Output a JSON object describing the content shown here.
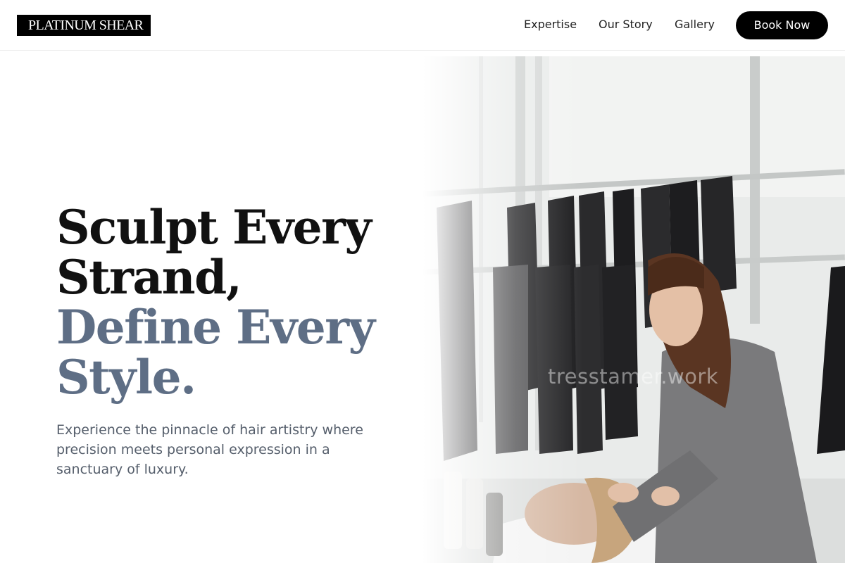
{
  "header": {
    "logo": "PLATINUM SHEAR",
    "nav": [
      {
        "label": "Expertise"
      },
      {
        "label": "Our Story"
      },
      {
        "label": "Gallery"
      }
    ],
    "cta_label": "Book Now"
  },
  "hero": {
    "headline_lines": [
      "Sculpt Every",
      "Strand,",
      "Define Every",
      "Style."
    ],
    "subtext": "Experience the pinnacle of hair artistry where precision meets personal expression in a sanctuary of luxury.",
    "image_watermark": "tresstamer.work"
  },
  "colors": {
    "accent": "#5e6e85",
    "text_dark": "#111111",
    "button_bg": "#000000"
  }
}
